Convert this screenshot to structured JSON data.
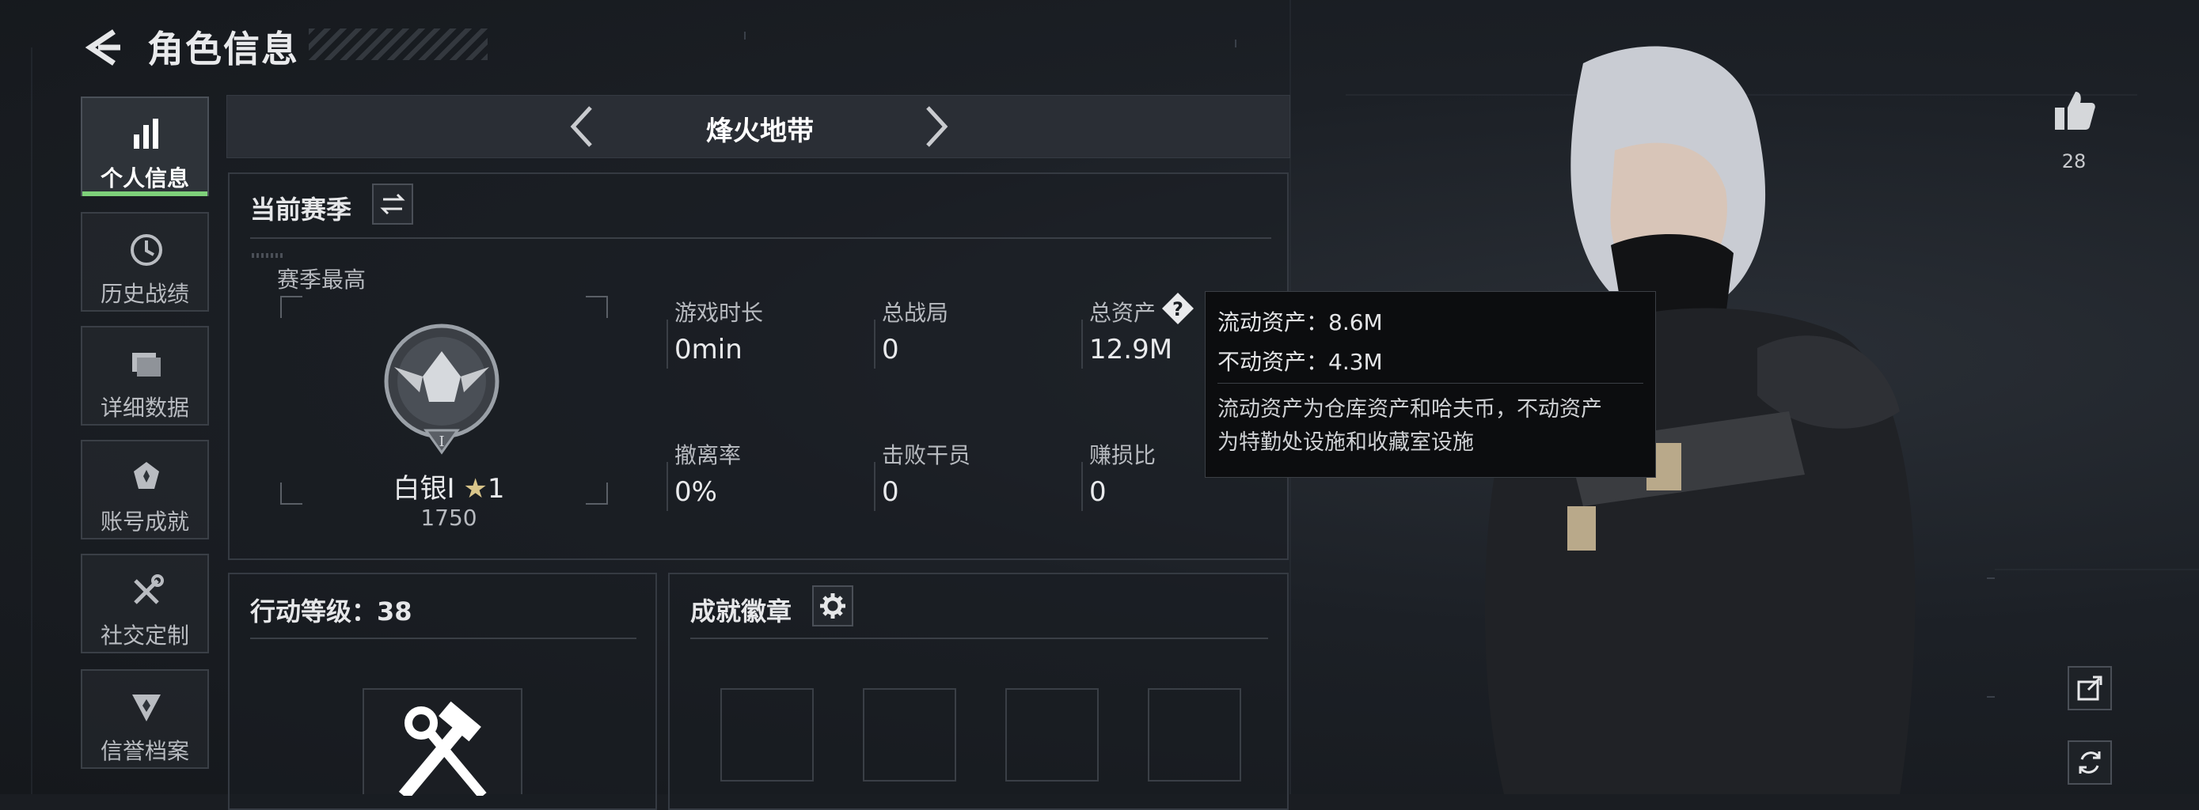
{
  "header": {
    "title": "角色信息"
  },
  "sidebar": {
    "items": [
      {
        "label": "个人信息",
        "icon": "bar-chart-icon",
        "active": true
      },
      {
        "label": "历史战绩",
        "icon": "clock-history-icon"
      },
      {
        "label": "详细数据",
        "icon": "folder-icon"
      },
      {
        "label": "账号成就",
        "icon": "achievement-icon"
      },
      {
        "label": "社交定制",
        "icon": "tools-icon"
      },
      {
        "label": "信誉档案",
        "icon": "shield-badge-icon"
      }
    ]
  },
  "mode": {
    "title": "烽火地带"
  },
  "season": {
    "title": "当前赛季",
    "best_label": "赛季最高",
    "rank_name": "白银I",
    "rank_stars": "1",
    "rank_points": "1750",
    "stats": [
      {
        "label": "游戏时长",
        "value": "0min"
      },
      {
        "label": "总战局",
        "value": "0"
      },
      {
        "label": "总资产",
        "value": "12.9M"
      },
      {
        "label": "撤离率",
        "value": "0%"
      },
      {
        "label": "击败干员",
        "value": "0"
      },
      {
        "label": "赚损比",
        "value": "0"
      }
    ]
  },
  "tooltip": {
    "liquid": "流动资产：8.6M",
    "fixed": "不动资产：4.3M",
    "desc_line1": "流动资产为仓库资产和哈夫币，不动资产",
    "desc_line2": "为特勤处设施和收藏室设施"
  },
  "action_level": {
    "title": "行动等级：38"
  },
  "badges": {
    "title": "成就徽章",
    "slots": 4
  },
  "likes": {
    "count": "28"
  },
  "colors": {
    "accent": "#7ed07a",
    "panel_border": "#353a42",
    "background": "#1a1d22"
  }
}
